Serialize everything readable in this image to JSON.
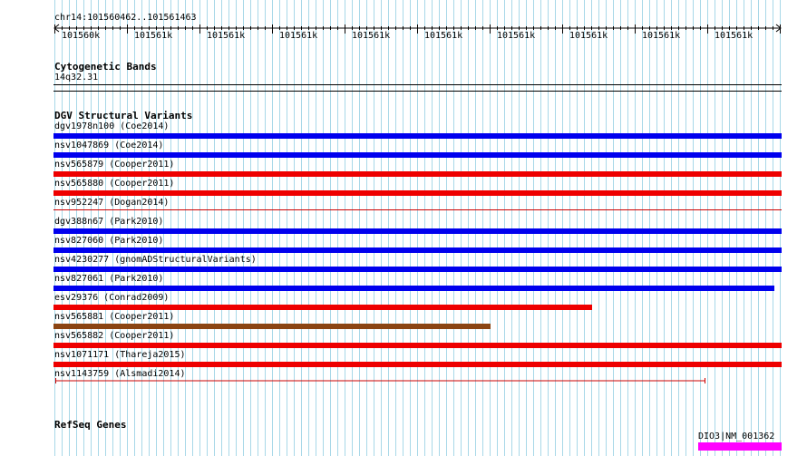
{
  "ruler": {
    "position": "chr14:101560462..101561463",
    "ticks": [
      "101560k",
      "101561k",
      "101561k",
      "101561k",
      "101561k",
      "101561k",
      "101561k",
      "101561k",
      "101561k",
      "101561k"
    ]
  },
  "cytoband": {
    "title": "Cytogenetic Bands",
    "band": "14q32.31"
  },
  "dgv": {
    "title": "DGV Structural Variants",
    "variants": [
      {
        "label": "dgv1978n100 (Coe2014)",
        "color": "#0000ee",
        "extent": 1.0
      },
      {
        "label": "nsv1047869 (Coe2014)",
        "color": "#0000ee",
        "extent": 1.0
      },
      {
        "label": "nsv565879 (Cooper2011)",
        "color": "#ee0000",
        "extent": 1.0
      },
      {
        "label": "nsv565880 (Cooper2011)",
        "color": "#ee0000",
        "extent": 1.0
      },
      {
        "label": "nsv952247 (Dogan2014)",
        "color": "#cc0000",
        "extent": 1.0
      },
      {
        "label": "dgv388n67 (Park2010)",
        "color": "#0000ee",
        "extent": 1.0
      },
      {
        "label": "nsv827060 (Park2010)",
        "color": "#0000ee",
        "extent": 1.0
      },
      {
        "label": "nsv4230277 (gnomADStructuralVariants)",
        "color": "#0000ee",
        "extent": 1.0
      },
      {
        "label": "nsv827061 (Park2010)",
        "color": "#0000ee",
        "extent": 0.99
      },
      {
        "label": "esv29376 (Conrad2009)",
        "color": "#ee0000",
        "extent": 0.74
      },
      {
        "label": "nsv565881 (Cooper2011)",
        "color": "#8b4513",
        "extent": 0.6
      },
      {
        "label": "nsv565882 (Cooper2011)",
        "color": "#ee0000",
        "extent": 1.0
      },
      {
        "label": "nsv1071171 (Thareja2015)",
        "color": "#ee0000",
        "extent": 1.0
      },
      {
        "label": "nsv1143759 (Alsmadi2014)",
        "color": "#cc0000",
        "extent": 0.895
      }
    ]
  },
  "refseq": {
    "title": "RefSeq Genes",
    "gene_label": "DIO3|NM_001362",
    "gene_color": "#ff00ff"
  },
  "grid_color": "#a8d8e8"
}
